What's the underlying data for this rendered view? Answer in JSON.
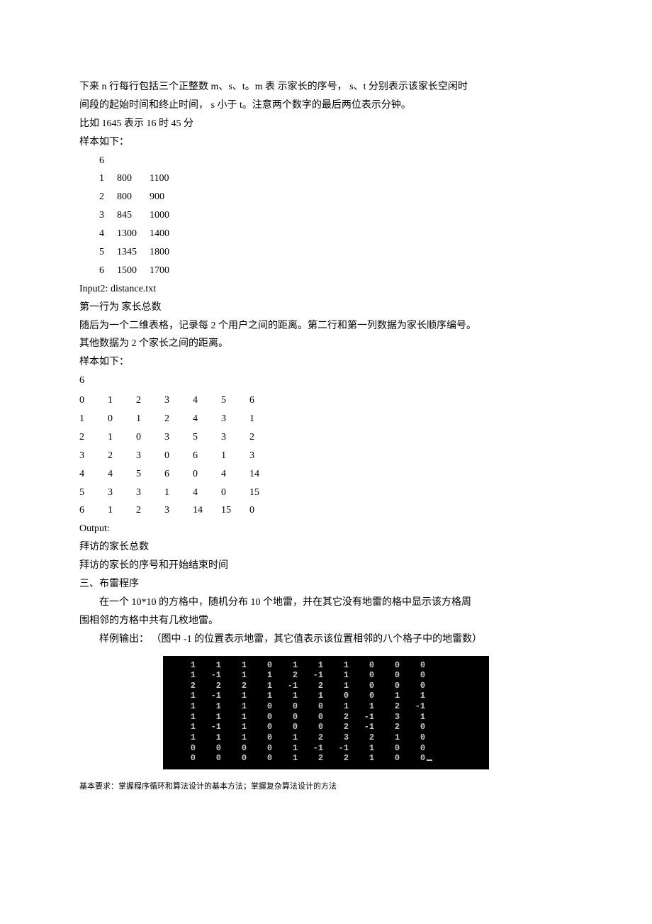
{
  "para1_l1": "下来 n 行每行包括三个正整数    m、s、t。m 表  示家长的序号，   s、t 分别表示该家长空闲时",
  "para1_l2": "间段的起始时间和终止时间，     s 小于 t。注意两个数字的最后两位表示分钟。",
  "para1_l3": "比如 1645  表示 16 时 45 分",
  "sample1_label": "样本如下：",
  "sample1_n": "6",
  "sample1_rows": [
    [
      "1",
      "800",
      "1100"
    ],
    [
      "2",
      "800",
      "900"
    ],
    [
      "3",
      "845",
      "1000"
    ],
    [
      "4",
      "1300",
      "1400"
    ],
    [
      "5",
      "1345",
      "1800"
    ],
    [
      "6",
      "1500",
      "1700"
    ]
  ],
  "input2_label": "Input2:    distance.txt",
  "input2_line1": "第一行为   家长总数",
  "input2_line2": "随后为一个二维表格，记录每     2 个用户之间的距离。第二行和第一列数据为家长顺序编号。",
  "input2_line3": "其他数据为  2 个家长之间的距离。",
  "sample2_label": "样本如下：",
  "sample2_n": "6",
  "sample2_rows": [
    [
      "0",
      "1",
      "2",
      "3",
      "4",
      "5",
      "6"
    ],
    [
      "1",
      "0",
      "1",
      "2",
      "4",
      "3",
      "1"
    ],
    [
      "2",
      "1",
      "0",
      "3",
      "5",
      "3",
      "2"
    ],
    [
      "3",
      "2",
      "3",
      "0",
      "6",
      "1",
      "3"
    ],
    [
      "4",
      "4",
      "5",
      "6",
      "0",
      "4",
      "14"
    ],
    [
      "5",
      "3",
      "3",
      "1",
      "4",
      "0",
      "15"
    ],
    [
      "6",
      "1",
      "2",
      "3",
      "14",
      "15",
      "0"
    ]
  ],
  "output_label": "Output:",
  "output_line1": "拜访的家长总数",
  "output_line2": "拜访的家长的序号和开始结束时间",
  "section3_title": "三、布雷程序",
  "section3_p1_l1": "在一个  10*10 的方格中，随机分布    10 个地雷，并在其它没有地雷的格中显示该方格周",
  "section3_p1_l2": "围相邻的方格中共有几枚地雷。",
  "section3_p2": "样例输出：  （图中 -1 的位置表示地雷，其它值表示该位置相邻的八个格子中的地雷数）",
  "chart_data": {
    "type": "table",
    "title": "10x10 minesweeper grid output (-1 = mine)",
    "rows": [
      [
        1,
        1,
        1,
        0,
        1,
        1,
        1,
        0,
        0,
        0
      ],
      [
        1,
        -1,
        1,
        1,
        2,
        -1,
        1,
        0,
        0,
        0
      ],
      [
        2,
        2,
        2,
        1,
        -1,
        2,
        1,
        0,
        0,
        0
      ],
      [
        1,
        -1,
        1,
        1,
        1,
        1,
        0,
        0,
        1,
        1
      ],
      [
        1,
        1,
        1,
        0,
        0,
        0,
        1,
        1,
        2,
        -1
      ],
      [
        1,
        1,
        1,
        0,
        0,
        0,
        2,
        -1,
        3,
        1
      ],
      [
        1,
        -1,
        1,
        0,
        0,
        0,
        2,
        -1,
        2,
        0
      ],
      [
        1,
        1,
        1,
        0,
        1,
        2,
        3,
        2,
        1,
        0
      ],
      [
        0,
        0,
        0,
        0,
        1,
        -1,
        -1,
        1,
        0,
        0
      ],
      [
        0,
        0,
        0,
        0,
        1,
        2,
        2,
        1,
        0,
        0
      ]
    ],
    "cursor_after_last_cell": true
  },
  "footer": "基本要求：掌握程序循环和算法设计的基本方法；掌握复杂算法设计的方法"
}
